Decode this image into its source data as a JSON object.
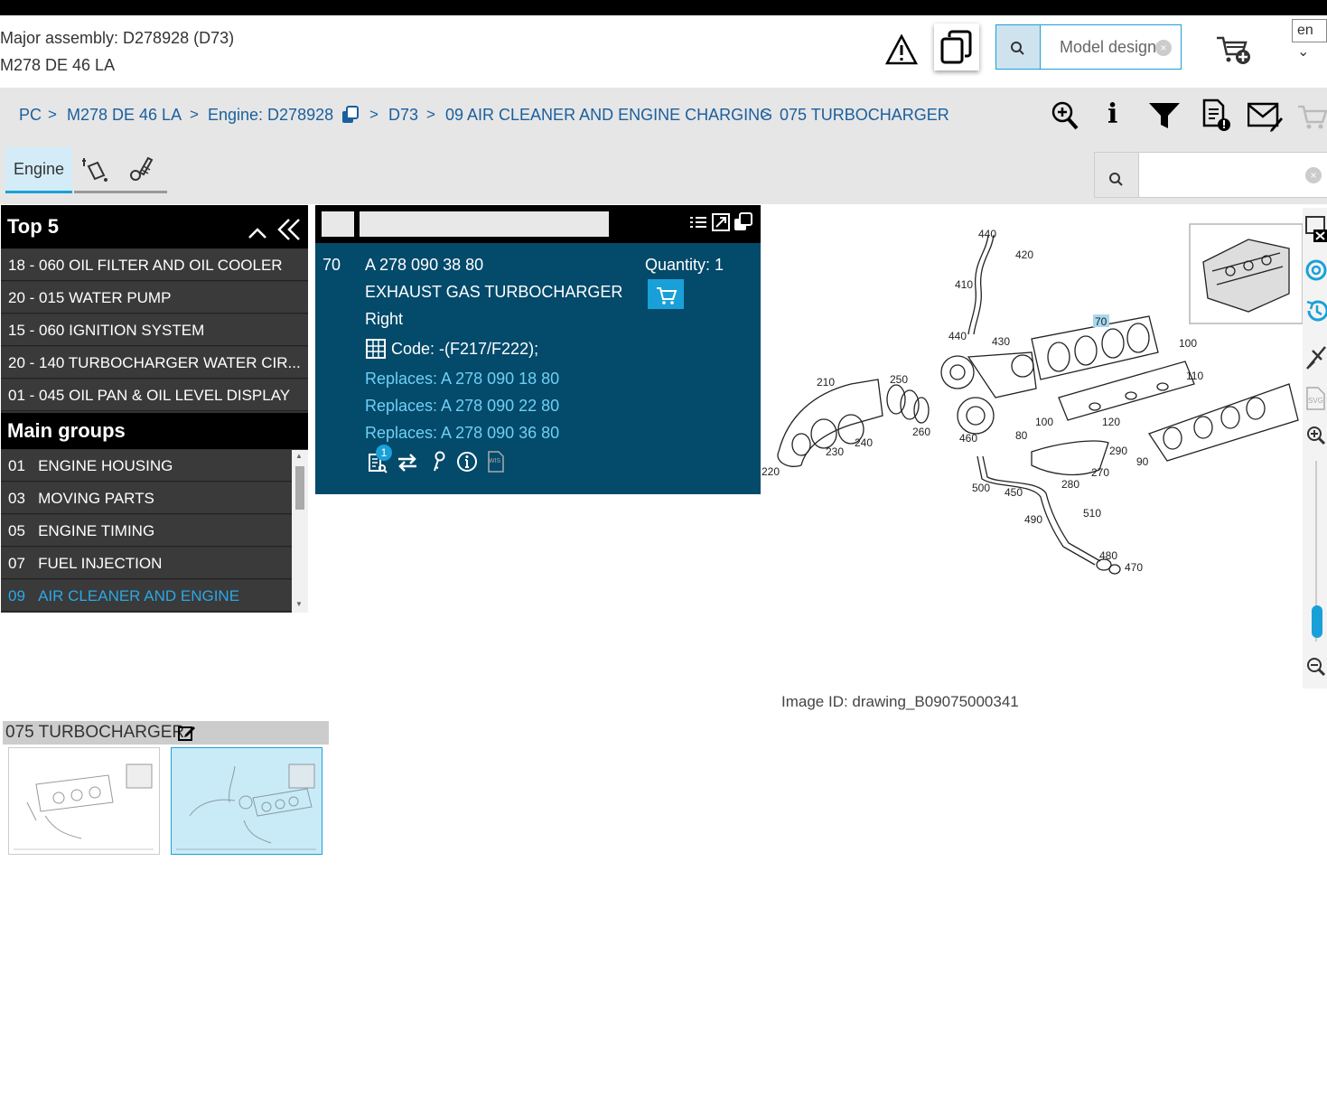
{
  "header": {
    "assembly_line": "Major assembly: D278928 (D73)",
    "model_line": "M278 DE 46 LA",
    "search_placeholder": "Model design",
    "language": "en"
  },
  "breadcrumb": {
    "items": [
      "PC",
      "M278 DE 46 LA",
      "Engine: D278928",
      "D73",
      "09 AIR CLEANER AND ENGINE CHARGING",
      "075 TURBOCHARGER"
    ],
    "separator": ">"
  },
  "tabs": {
    "engine_label": "Engine"
  },
  "left_panel": {
    "top5_title": "Top 5",
    "top5": [
      "18 - 060 OIL FILTER AND OIL COOLER",
      "20 - 015 WATER PUMP",
      "15 - 060 IGNITION SYSTEM",
      "20 - 140 TURBOCHARGER WATER CIR...",
      "01 - 045 OIL PAN & OIL LEVEL DISPLAY"
    ],
    "main_groups_title": "Main groups",
    "main_groups": [
      {
        "num": "01",
        "name": "ENGINE HOUSING"
      },
      {
        "num": "03",
        "name": "MOVING PARTS"
      },
      {
        "num": "05",
        "name": "ENGINE TIMING"
      },
      {
        "num": "07",
        "name": "FUEL INJECTION"
      },
      {
        "num": "09",
        "name": "AIR CLEANER AND ENGINE"
      }
    ]
  },
  "part": {
    "position": "70",
    "number": "A 278 090 38 80",
    "name": "EXHAUST GAS TURBOCHARGER",
    "side": "Right",
    "code": "Code: -(F217/F222);",
    "quantity_label": "Quantity: 1",
    "replaces": [
      "Replaces: A 278 090 18 80",
      "Replaces: A 278 090 22 80",
      "Replaces: A 278 090 36 80"
    ],
    "notes_badge": "1",
    "wis_label": "WIS"
  },
  "diagram": {
    "callouts": [
      "440",
      "420",
      "410",
      "440",
      "430",
      "70",
      "100",
      "110",
      "210",
      "250",
      "100",
      "120",
      "260",
      "240",
      "80",
      "460",
      "290",
      "230",
      "220",
      "270",
      "90",
      "500",
      "450",
      "280",
      "490",
      "510",
      "480",
      "470"
    ],
    "highlight_color": "#a8d8f0",
    "svg_label": "SVG"
  },
  "image_id": "Image ID: drawing_B09075000341",
  "subgroup": {
    "title": "075 TURBOCHARGER"
  },
  "colors": {
    "accent": "#1aa0d8",
    "part_panel": "#034a6b",
    "breadcrumb": "#1a5f9e"
  }
}
